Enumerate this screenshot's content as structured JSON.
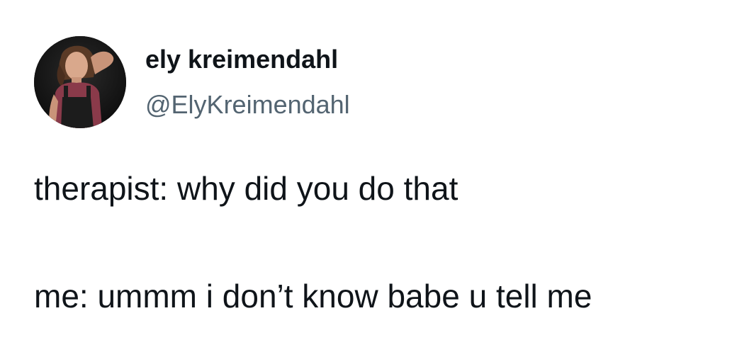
{
  "author": {
    "display_name": "ely kreimendahl",
    "handle": "@ElyKreimendahl"
  },
  "tweet": {
    "lines": [
      "therapist: why did you do that",
      "me: ummm i don’t know babe u tell me"
    ]
  },
  "icons": {
    "avatar": "profile-photo"
  },
  "colors": {
    "text": "#0f1419",
    "secondary_text": "#536471",
    "background": "#ffffff"
  }
}
